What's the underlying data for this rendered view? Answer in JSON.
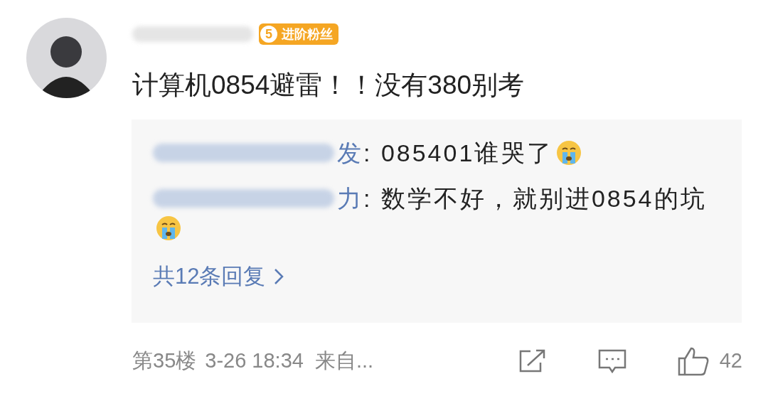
{
  "comment": {
    "badge": {
      "level": "5",
      "label": "进阶粉丝"
    },
    "text": "计算机0854避雷！！没有380别考",
    "replies": [
      {
        "name": "发",
        "text": ": 085401谁哭了"
      },
      {
        "name": "力",
        "text": ": 数学不好，就别进0854的坑"
      }
    ],
    "more_replies": "共12条回复",
    "footer": {
      "floor": "第35楼",
      "time": "3-26 18:34",
      "source": "来自...",
      "likes": "42"
    }
  }
}
